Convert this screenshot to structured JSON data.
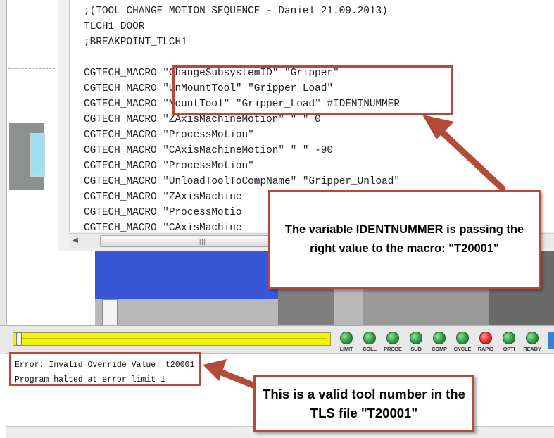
{
  "editor": {
    "lines": [
      ";(TOOL CHANGE MOTION SEQUENCE - Daniel 21.09.2013)",
      "TLCH1_DOOR",
      ";BREAKPOINT_TLCH1",
      "",
      "CGTECH_MACRO \"ChangeSubsystemID\" \"Gripper\"",
      "CGTECH_MACRO \"UnMountTool\" \"Gripper_Load\"",
      "CGTECH_MACRO \"MountTool\" \"Gripper_Load\" #IDENTNUMMER",
      "CGTECH_MACRO \"ZAxisMachineMotion\" \" \" 0",
      "CGTECH_MACRO \"ProcessMotion\"",
      "CGTECH_MACRO \"CAxisMachineMotion\" \" \" -90",
      "CGTECH_MACRO \"ProcessMotion\"",
      "CGTECH_MACRO \"UnloadToolToCompName\" \"Gripper_Unload\"",
      "CGTECH_MACRO \"ZAxisMachine",
      "CGTECH_MACRO \"ProcessMotio",
      "CGTECH_MACRO \"CAxisMachine"
    ]
  },
  "controls": {
    "progress": 0.0,
    "leds": [
      {
        "label": "LIMIT",
        "color": "#2f9a42"
      },
      {
        "label": "COLL",
        "color": "#2f9a42"
      },
      {
        "label": "PROBE",
        "color": "#2f9a42"
      },
      {
        "label": "SUB",
        "color": "#2f9a42"
      },
      {
        "label": "COMP",
        "color": "#2f9a42"
      },
      {
        "label": "CYCLE",
        "color": "#2f9a42"
      },
      {
        "label": "RAPID",
        "color": "#e52a2a"
      },
      {
        "label": "OPTI",
        "color": "#2f9a42"
      },
      {
        "label": "READY",
        "color": "#2f9a42"
      }
    ]
  },
  "log": {
    "lines": [
      "Error: Invalid Override Value: t20001",
      "Program halted at error limit 1"
    ]
  },
  "annotations": {
    "callout_variable": "The variable IDENTNUMMER is passing the right value to the macro: \"T20001\"",
    "callout_tool": "This is a valid tool number in the TLS file \"T20001\"",
    "accent_color": "#b34a3a"
  }
}
